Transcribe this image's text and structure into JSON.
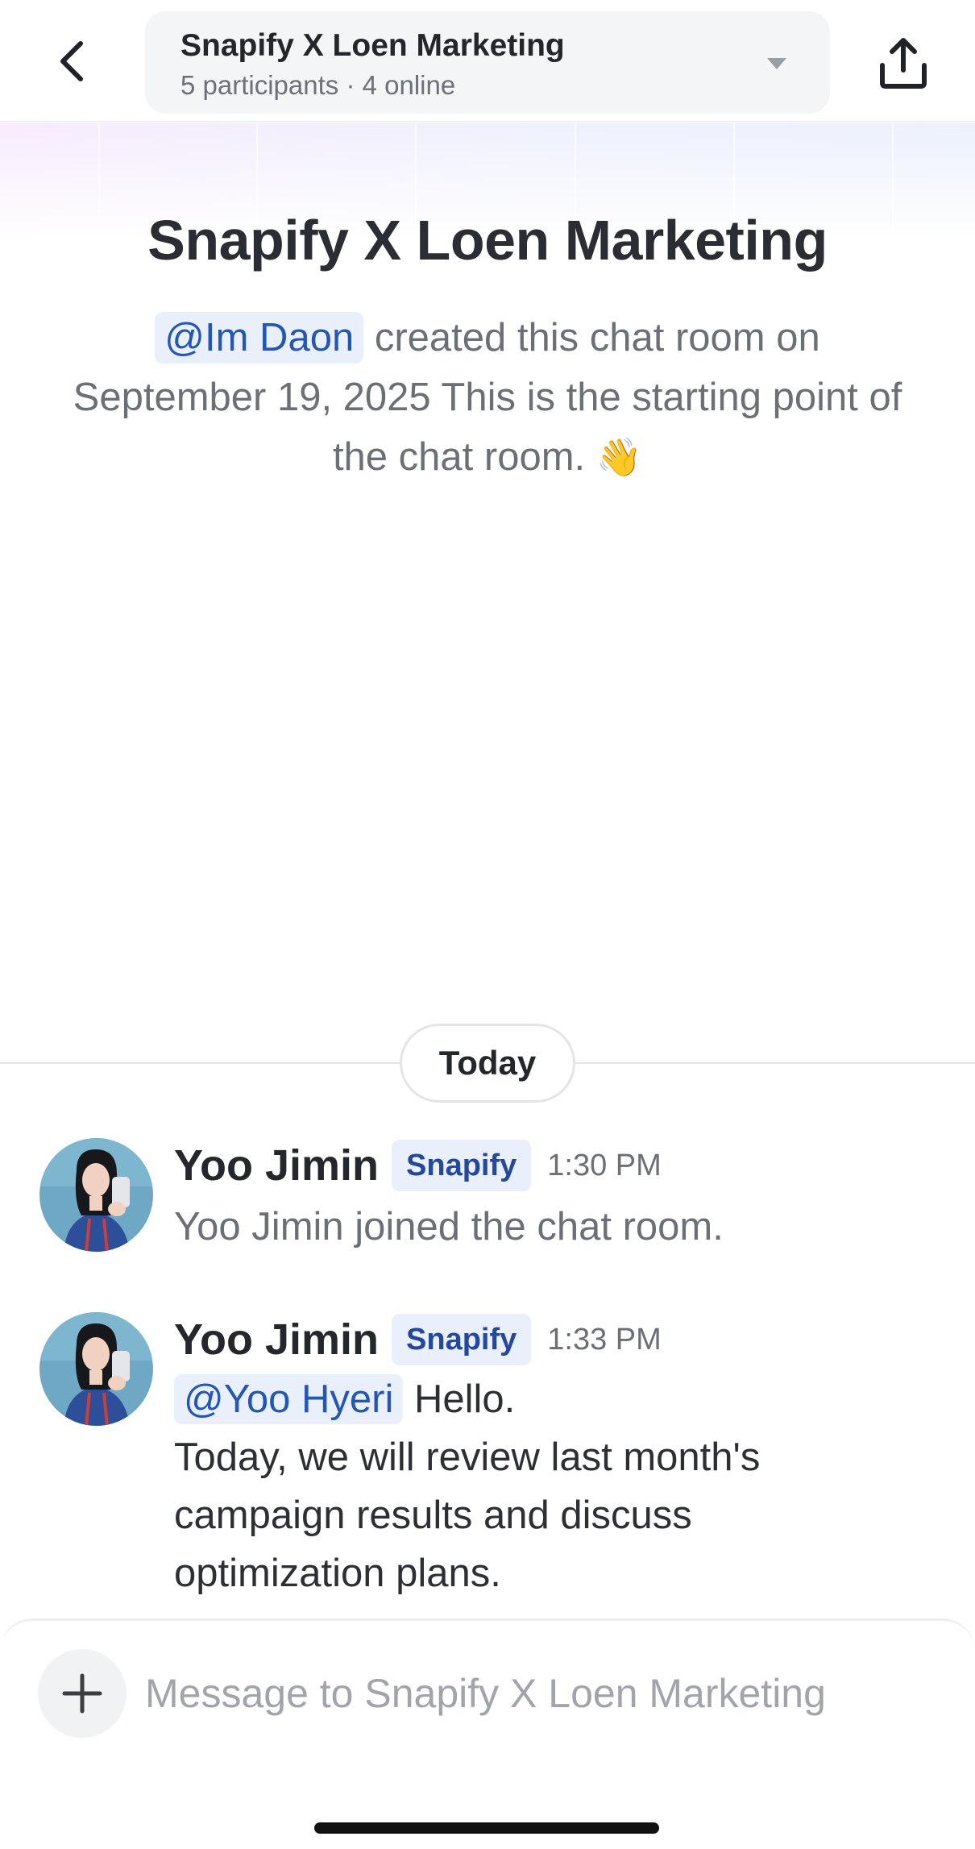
{
  "header": {
    "back_icon": "chevron-left-icon",
    "room_name": "Snapify X Loen Marketing",
    "room_status": "5 participants · 4 online",
    "dropdown_icon": "caret-down-icon",
    "share_icon": "share-upload-icon"
  },
  "intro": {
    "title": "Snapify X Loen Marketing",
    "creator_mention": "@Im Daon",
    "text_line1": " created this chat room on",
    "text_line2": "September 19, 2025 This is the starting point of the chat room.",
    "emoji": "👋"
  },
  "divider": {
    "label": "Today"
  },
  "messages": [
    {
      "sender": "Yoo Jimin",
      "badge": "Snapify",
      "time": "1:30 PM",
      "text": "Yoo Jimin joined the chat room."
    },
    {
      "sender": "Yoo Jimin",
      "badge": "Snapify",
      "time": "1:33 PM",
      "mention": "@Yoo Hyeri",
      "line1": " Hello.",
      "body": "Today, we will review last month's campaign results and discuss optimization plans."
    }
  ],
  "composer": {
    "add_icon": "plus-icon",
    "placeholder": "Message to Snapify X Loen Marketing"
  },
  "colors": {
    "mention_bg": "#e9f0fb",
    "mention_text": "#2457b3",
    "badge_text": "#24489c"
  }
}
